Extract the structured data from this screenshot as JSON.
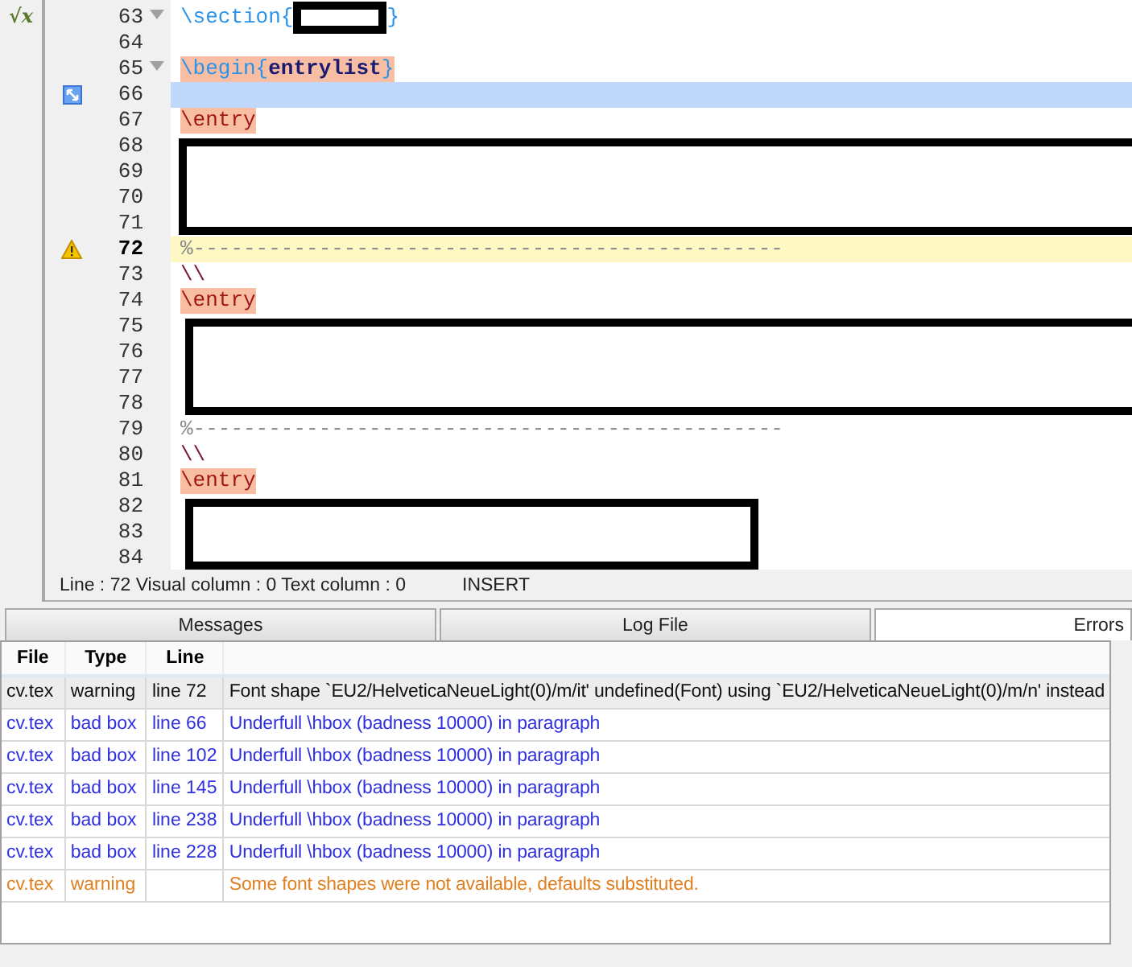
{
  "sidebar": {
    "icon_label": "√x"
  },
  "editor": {
    "lines": [
      {
        "number": "63",
        "bookmark": false,
        "warning": false,
        "fold": true,
        "current": false,
        "redacted": false,
        "segments": [
          {
            "kind": "section",
            "text": "\\section{"
          },
          {
            "kind": "redacted"
          },
          {
            "kind": "section",
            "text": "}"
          }
        ]
      },
      {
        "number": "64",
        "bookmark": false,
        "warning": false,
        "fold": false,
        "current": false,
        "redacted": false
      },
      {
        "number": "65",
        "bookmark": false,
        "warning": false,
        "fold": true,
        "current": false,
        "redacted": false,
        "segments": [
          {
            "kind": "env",
            "text": "\\begin{"
          },
          {
            "kind": "env-name",
            "text": "entrylist"
          },
          {
            "kind": "env",
            "text": "}"
          }
        ]
      },
      {
        "number": "66",
        "bookmark": true,
        "warning": false,
        "fold": false,
        "current": false,
        "redacted": false
      },
      {
        "number": "67",
        "bookmark": false,
        "warning": false,
        "fold": false,
        "current": false,
        "redacted": false,
        "segments": [
          {
            "kind": "entry",
            "text": "\\entry"
          }
        ]
      },
      {
        "number": "68",
        "bookmark": false,
        "warning": false,
        "fold": false,
        "current": false,
        "redacted": true
      },
      {
        "number": "69",
        "bookmark": false,
        "warning": false,
        "fold": false,
        "current": false,
        "redacted": true
      },
      {
        "number": "70",
        "bookmark": false,
        "warning": false,
        "fold": false,
        "current": false,
        "redacted": true
      },
      {
        "number": "71",
        "bookmark": false,
        "warning": false,
        "fold": false,
        "current": false,
        "redacted": true
      },
      {
        "number": "72",
        "bookmark": false,
        "warning": true,
        "fold": false,
        "current": true,
        "redacted": false,
        "segments": [
          {
            "kind": "comment",
            "text": "%-----------------------------------------------"
          }
        ]
      },
      {
        "number": "73",
        "bookmark": false,
        "warning": false,
        "fold": false,
        "current": false,
        "redacted": false,
        "segments": [
          {
            "kind": "linebreak",
            "text": "\\\\"
          }
        ]
      },
      {
        "number": "74",
        "bookmark": false,
        "warning": false,
        "fold": false,
        "current": false,
        "redacted": false,
        "segments": [
          {
            "kind": "entry",
            "text": "\\entry"
          }
        ]
      },
      {
        "number": "75",
        "bookmark": false,
        "warning": false,
        "fold": false,
        "current": false,
        "redacted": true
      },
      {
        "number": "76",
        "bookmark": false,
        "warning": false,
        "fold": false,
        "current": false,
        "redacted": true
      },
      {
        "number": "77",
        "bookmark": false,
        "warning": false,
        "fold": false,
        "current": false,
        "redacted": true
      },
      {
        "number": "78",
        "bookmark": false,
        "warning": false,
        "fold": false,
        "current": false,
        "redacted": true
      },
      {
        "number": "79",
        "bookmark": false,
        "warning": false,
        "fold": false,
        "current": false,
        "redacted": false,
        "segments": [
          {
            "kind": "comment",
            "text": "%-----------------------------------------------"
          }
        ]
      },
      {
        "number": "80",
        "bookmark": false,
        "warning": false,
        "fold": false,
        "current": false,
        "redacted": false,
        "segments": [
          {
            "kind": "linebreak",
            "text": "\\\\"
          }
        ]
      },
      {
        "number": "81",
        "bookmark": false,
        "warning": false,
        "fold": false,
        "current": false,
        "redacted": false,
        "segments": [
          {
            "kind": "entry",
            "text": "\\entry"
          }
        ]
      },
      {
        "number": "82",
        "bookmark": false,
        "warning": false,
        "fold": false,
        "current": false,
        "redacted": true
      },
      {
        "number": "83",
        "bookmark": false,
        "warning": false,
        "fold": false,
        "current": false,
        "redacted": true
      },
      {
        "number": "84",
        "bookmark": false,
        "warning": false,
        "fold": false,
        "current": false,
        "redacted": true
      }
    ]
  },
  "status_bar": {
    "position": "Line : 72 Visual column : 0 Text column : 0",
    "mode": "INSERT"
  },
  "tabs": [
    {
      "label": "Messages",
      "selected": false
    },
    {
      "label": "Log File",
      "selected": false
    },
    {
      "label": "Errors",
      "selected": true
    }
  ],
  "table": {
    "columns": [
      "File",
      "Type",
      "Line"
    ],
    "rows": [
      {
        "kind": "warning",
        "selected": true,
        "cells": [
          "cv.tex",
          "warning",
          "line 72",
          "Font shape `EU2/HelveticaNeueLight(0)/m/it' undefined(Font) using `EU2/HelveticaNeueLight(0)/m/n' instead"
        ]
      },
      {
        "kind": "badbox",
        "selected": false,
        "cells": [
          "cv.tex",
          "bad box",
          "line 66",
          "Underfull \\hbox (badness 10000) in paragraph"
        ]
      },
      {
        "kind": "badbox",
        "selected": false,
        "cells": [
          "cv.tex",
          "bad box",
          "line 102",
          "Underfull \\hbox (badness 10000) in paragraph"
        ]
      },
      {
        "kind": "badbox",
        "selected": false,
        "cells": [
          "cv.tex",
          "bad box",
          "line 145",
          "Underfull \\hbox (badness 10000) in paragraph"
        ]
      },
      {
        "kind": "badbox",
        "selected": false,
        "cells": [
          "cv.tex",
          "bad box",
          "line 238",
          "Underfull \\hbox (badness 10000) in paragraph"
        ]
      },
      {
        "kind": "badbox",
        "selected": false,
        "cells": [
          "cv.tex",
          "bad box",
          "line 228",
          "Underfull \\hbox (badness 10000) in paragraph"
        ]
      },
      {
        "kind": "warning",
        "selected": false,
        "cells": [
          "cv.tex",
          "warning",
          null,
          "Some font shapes were not available, defaults substituted."
        ]
      }
    ]
  }
}
